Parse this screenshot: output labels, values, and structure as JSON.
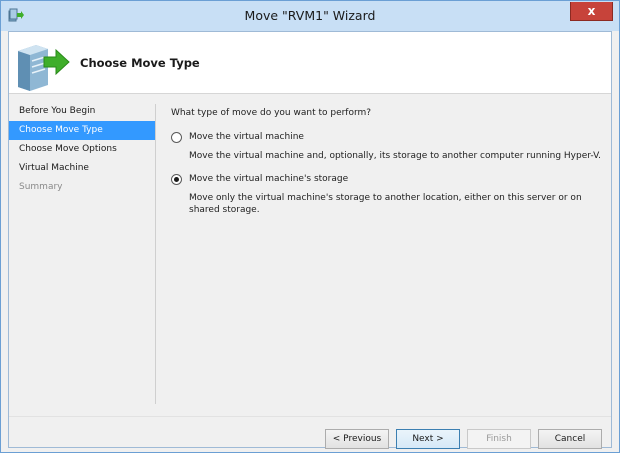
{
  "window": {
    "title": "Move \"RVM1\" Wizard",
    "close_label": "x"
  },
  "header": {
    "page_title": "Choose Move Type"
  },
  "nav": {
    "items": [
      {
        "label": "Before You Begin"
      },
      {
        "label": "Choose Move Type"
      },
      {
        "label": "Choose Move Options"
      },
      {
        "label": "Virtual Machine"
      },
      {
        "label": "Summary"
      }
    ],
    "selected": "Choose Move Type"
  },
  "content": {
    "question": "What type of move do you want to perform?",
    "options": [
      {
        "label": "Move the virtual machine",
        "description": "Move the virtual machine and, optionally, its storage to another computer running Hyper-V.",
        "checked": false
      },
      {
        "label": "Move the virtual machine's storage",
        "description": "Move only the virtual machine's storage to another location, either on this server or on shared storage.",
        "checked": true
      }
    ]
  },
  "buttons": {
    "previous": "< Previous",
    "next": "Next >",
    "finish": "Finish",
    "cancel": "Cancel"
  },
  "colors": {
    "selection": "#3399ff",
    "titlebar": "#c8dff5",
    "close": "#c7433a"
  }
}
